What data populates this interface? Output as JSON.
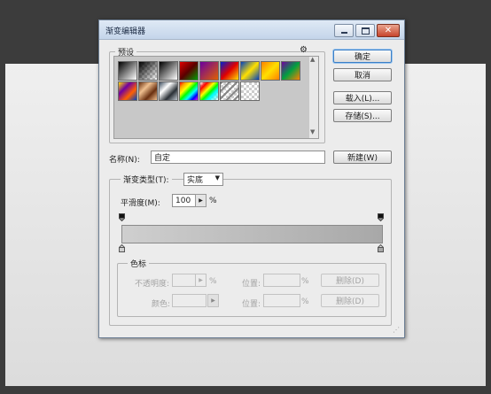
{
  "dialog": {
    "title": "渐变编辑器",
    "presets_label": "预设",
    "buttons": {
      "ok": "确定",
      "cancel": "取消",
      "load": "载入(L)...",
      "save": "存储(S)...",
      "new": "新建(W)"
    },
    "name_label": "名称(N):",
    "name_value": "自定",
    "gradient_type_label": "渐变类型(T):",
    "gradient_type_value": "实底",
    "smoothness_label": "平滑度(M):",
    "smoothness_value": "100",
    "smoothness_unit": "%",
    "stops_group_label": "色标",
    "opacity_label": "不透明度:",
    "opacity_unit": "%",
    "color_label": "颜色:",
    "location_label": "位置:",
    "location_unit": "%",
    "delete_label": "删除(D)"
  },
  "presets": [
    {
      "icon": "black-white-gradient"
    },
    {
      "icon": "black-transparent-gradient"
    },
    {
      "icon": "black-white-gradient-2"
    },
    {
      "icon": "red-green-gradient"
    },
    {
      "icon": "violet-orange-gradient"
    },
    {
      "icon": "blue-red-yellow-gradient"
    },
    {
      "icon": "blue-yellow-blue-gradient"
    },
    {
      "icon": "orange-yellow-orange-gradient"
    },
    {
      "icon": "violet-green-orange-gradient"
    },
    {
      "icon": "yellow-violet-orange-blue-gradient"
    },
    {
      "icon": "copper-gradient"
    },
    {
      "icon": "chrome-gradient"
    },
    {
      "icon": "spectrum-gradient"
    },
    {
      "icon": "transparent-rainbow-gradient"
    },
    {
      "icon": "transparent-stripes-gradient"
    },
    {
      "icon": "transparent-checker-gradient"
    }
  ],
  "colors": {
    "ok_button_border": "#3b7fc6",
    "close_button": "#c7442c",
    "gradient_start": "#cfcfcf",
    "gradient_end": "#a8a8a8"
  }
}
